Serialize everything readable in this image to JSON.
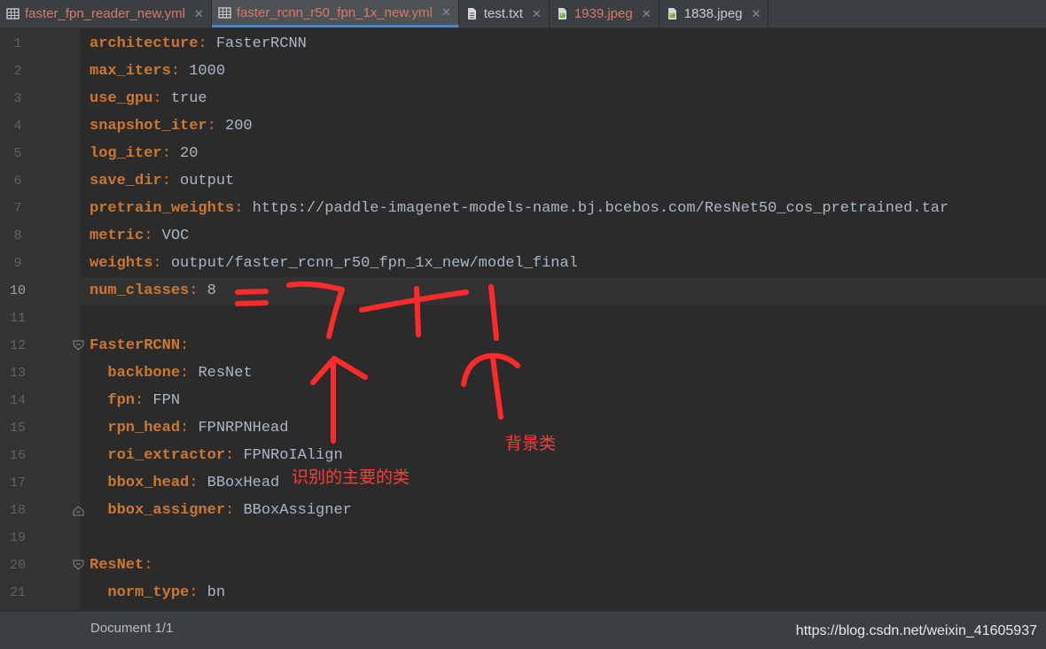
{
  "tabs": [
    {
      "label": "faster_fpn_reader_new.yml",
      "icon": "table-icon",
      "modified": true,
      "active": false
    },
    {
      "label": "faster_rcnn_r50_fpn_1x_new.yml",
      "icon": "table-icon",
      "modified": true,
      "active": true
    },
    {
      "label": "test.txt",
      "icon": "text-file-icon",
      "modified": false,
      "active": false
    },
    {
      "label": "1939.jpeg",
      "icon": "image-file-icon",
      "modified": true,
      "active": false
    },
    {
      "label": "1838.jpeg",
      "icon": "image-file-icon",
      "modified": false,
      "active": false
    }
  ],
  "editor": {
    "current_line": 10,
    "lines": [
      {
        "n": "1",
        "indent": "",
        "key": "architecture",
        "value": "FasterRCNN"
      },
      {
        "n": "2",
        "indent": "",
        "key": "max_iters",
        "value": "1000"
      },
      {
        "n": "3",
        "indent": "",
        "key": "use_gpu",
        "value": "true"
      },
      {
        "n": "4",
        "indent": "",
        "key": "snapshot_iter",
        "value": "200"
      },
      {
        "n": "5",
        "indent": "",
        "key": "log_iter",
        "value": "20"
      },
      {
        "n": "6",
        "indent": "",
        "key": "save_dir",
        "value": "output"
      },
      {
        "n": "7",
        "indent": "",
        "key": "pretrain_weights",
        "value": "https://paddle-imagenet-models-name.bj.bcebos.com/ResNet50_cos_pretrained.tar"
      },
      {
        "n": "8",
        "indent": "",
        "key": "metric",
        "value": "VOC"
      },
      {
        "n": "9",
        "indent": "",
        "key": "weights",
        "value": "output/faster_rcnn_r50_fpn_1x_new/model_final"
      },
      {
        "n": "10",
        "indent": "",
        "key": "num_classes",
        "value": "8"
      },
      {
        "n": "11",
        "indent": "",
        "key": "",
        "value": ""
      },
      {
        "n": "12",
        "indent": "",
        "key": "FasterRCNN",
        "value": ""
      },
      {
        "n": "13",
        "indent": "  ",
        "key": "backbone",
        "value": "ResNet"
      },
      {
        "n": "14",
        "indent": "  ",
        "key": "fpn",
        "value": "FPN"
      },
      {
        "n": "15",
        "indent": "  ",
        "key": "rpn_head",
        "value": "FPNRPNHead"
      },
      {
        "n": "16",
        "indent": "  ",
        "key": "roi_extractor",
        "value": "FPNRoIAlign"
      },
      {
        "n": "17",
        "indent": "  ",
        "key": "bbox_head",
        "value": "BBoxHead"
      },
      {
        "n": "18",
        "indent": "  ",
        "key": "bbox_assigner",
        "value": "BBoxAssigner"
      },
      {
        "n": "19",
        "indent": "",
        "key": "",
        "value": ""
      },
      {
        "n": "20",
        "indent": "",
        "key": "ResNet",
        "value": ""
      },
      {
        "n": "21",
        "indent": "  ",
        "key": "norm_type",
        "value": "bn"
      }
    ]
  },
  "status": {
    "document": "Document 1/1"
  },
  "watermark": "https://blog.csdn.net/weixin_41605937",
  "annotations": {
    "main_classes": "识别的主要的类",
    "background_class": "背景类"
  },
  "colors": {
    "annotation": "#ff3b3b",
    "key": "#cc7832",
    "value": "#a9b7c6"
  }
}
